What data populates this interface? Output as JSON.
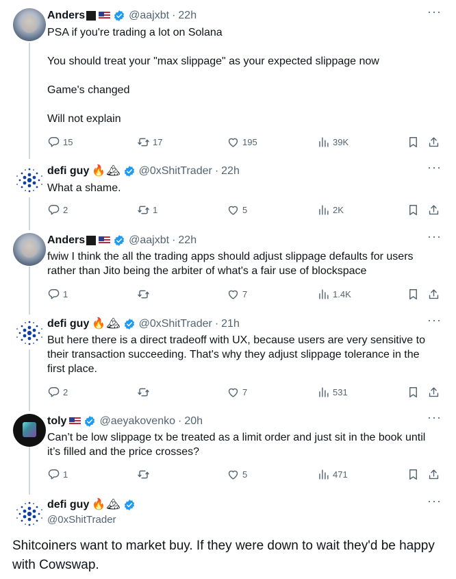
{
  "tweets": [
    {
      "name": "Anders",
      "handle": "@aajxbt",
      "time": "22h",
      "text": [
        "PSA if you're trading a lot on Solana",
        "You should treat your \"max slippage\" as your expected slippage now",
        "Game's changed",
        "Will not explain"
      ],
      "replies": "15",
      "retweets": "17",
      "likes": "195",
      "views": "39K"
    },
    {
      "name": "defi guy",
      "handle": "@0xShitTrader",
      "time": "22h",
      "text": [
        "What a shame."
      ],
      "replies": "2",
      "retweets": "1",
      "likes": "5",
      "views": "2K"
    },
    {
      "name": "Anders",
      "handle": "@aajxbt",
      "time": "22h",
      "text": [
        "fwiw I think the all the trading apps should adjust slippage defaults for users rather than Jito being the arbiter of what's a fair use of blockspace"
      ],
      "replies": "1",
      "retweets": "",
      "likes": "7",
      "views": "1.4K"
    },
    {
      "name": "defi guy",
      "handle": "@0xShitTrader",
      "time": "21h",
      "text": [
        "But here there is a direct tradeoff with UX, because users are very sensitive to their transaction succeeding. That's why they adjust slippage tolerance in the first place."
      ],
      "replies": "2",
      "retweets": "",
      "likes": "7",
      "views": "531"
    },
    {
      "name": "toly",
      "handle": "@aeyakovenko",
      "time": "20h",
      "text": [
        "Can’t be low slippage tx be treated as a limit order and just sit in the book until it’s filled and the price crosses?"
      ],
      "replies": "1",
      "retweets": "",
      "likes": "5",
      "views": "471"
    }
  ],
  "main": {
    "name": "defi guy",
    "handle": "@0xShitTrader",
    "text": "Shitcoiners want to market buy. If they were down to wait they'd be happy with Cowswap."
  },
  "icons": {
    "more": "more-icon",
    "reply": "reply-icon",
    "retweet": "retweet-icon",
    "like": "like-icon",
    "views": "views-icon",
    "bookmark": "bookmark-icon",
    "share": "share-icon",
    "verified": "verified-badge-icon"
  },
  "colors": {
    "text": "#0f1419",
    "secondary": "#536471",
    "verified": "#1d9bf0",
    "thread_line": "#cfd9de"
  }
}
